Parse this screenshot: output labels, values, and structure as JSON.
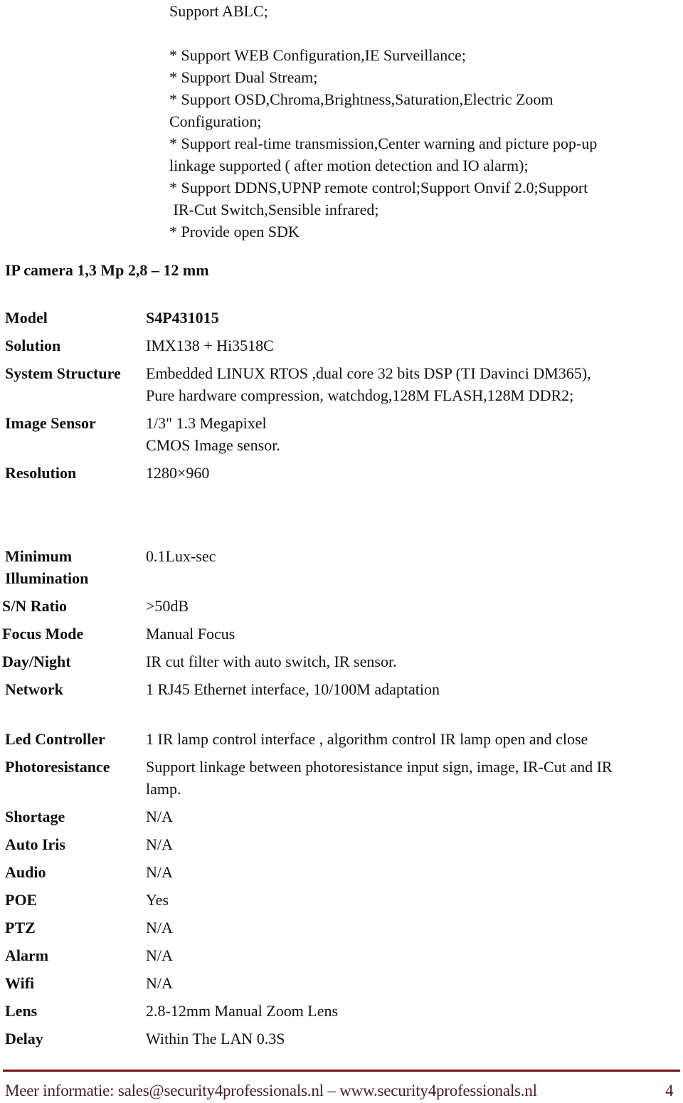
{
  "features": {
    "lines": [
      "Support ABLC;",
      "",
      "* Support WEB Configuration,IE Surveillance;",
      "* Support Dual Stream;",
      "* Support OSD,Chroma,Brightness,Saturation,Electric Zoom",
      "Configuration;",
      "* Support real-time transmission,Center warning and picture pop-up",
      "linkage supported ( after motion detection and IO alarm);",
      "* Support DDNS,UPNP remote control;Support Onvif 2.0;Support",
      " IR-Cut Switch,Sensible infrared;",
      "* Provide open SDK"
    ]
  },
  "product": {
    "heading": "IP camera 1,3 Mp 2,8 – 12 mm"
  },
  "specs": [
    {
      "label": "Model",
      "value": [
        "S4P431015"
      ]
    },
    {
      "label": "Solution",
      "value": [
        "IMX138 + Hi3518C"
      ]
    },
    {
      "label": "System Structure",
      "value": [
        "Embedded LINUX RTOS ,dual core 32 bits DSP (TI Davinci DM365),",
        "Pure hardware compression, watchdog,128M FLASH,128M DDR2;"
      ]
    },
    {
      "label": "Image Sensor",
      "value": [
        "1/3\" 1.3 Megapixel",
        "CMOS Image sensor."
      ]
    },
    {
      "label": "Resolution",
      "value": [
        "1280×960"
      ]
    },
    {
      "label": [
        "Minimum",
        "Illumination"
      ],
      "value": [
        "0.1Lux-sec"
      ]
    },
    {
      "label": "S/N Ratio",
      "value": [
        ">50dB"
      ]
    },
    {
      "label": "Focus Mode",
      "value": [
        "Manual Focus"
      ]
    },
    {
      "label": "Day/Night",
      "value": [
        "IR cut filter with auto switch, IR sensor."
      ]
    },
    {
      "label": "Network",
      "value": [
        "1 RJ45 Ethernet interface, 10/100M adaptation"
      ]
    },
    {
      "label": "Led Controller",
      "value": [
        "1 IR lamp control interface , algorithm control IR lamp open and close"
      ]
    },
    {
      "label": "Photoresistance",
      "value": [
        "Support linkage between photoresistance input sign, image, IR-Cut and IR",
        "lamp."
      ]
    },
    {
      "label": "Shortage",
      "value": [
        "N/A"
      ]
    },
    {
      "label": "Auto Iris",
      "value": [
        "N/A"
      ]
    },
    {
      "label": "Audio",
      "value": [
        "N/A"
      ]
    },
    {
      "label": "POE",
      "value": [
        "Yes"
      ]
    },
    {
      "label": "PTZ",
      "value": [
        "N/A"
      ]
    },
    {
      "label": "Alarm",
      "value": [
        "N/A"
      ]
    },
    {
      "label": "Wifi",
      "value": [
        "N/A"
      ]
    },
    {
      "label": "Lens",
      "value": [
        "2.8-12mm Manual Zoom Lens"
      ]
    },
    {
      "label": "Delay",
      "value": [
        "Within The LAN 0.3S"
      ]
    }
  ],
  "footer": {
    "text": "Meer informatie: sales@security4professionals.nl – www.security4professionals.nl",
    "page_number": "4",
    "rule_color": "#7a0c12"
  }
}
